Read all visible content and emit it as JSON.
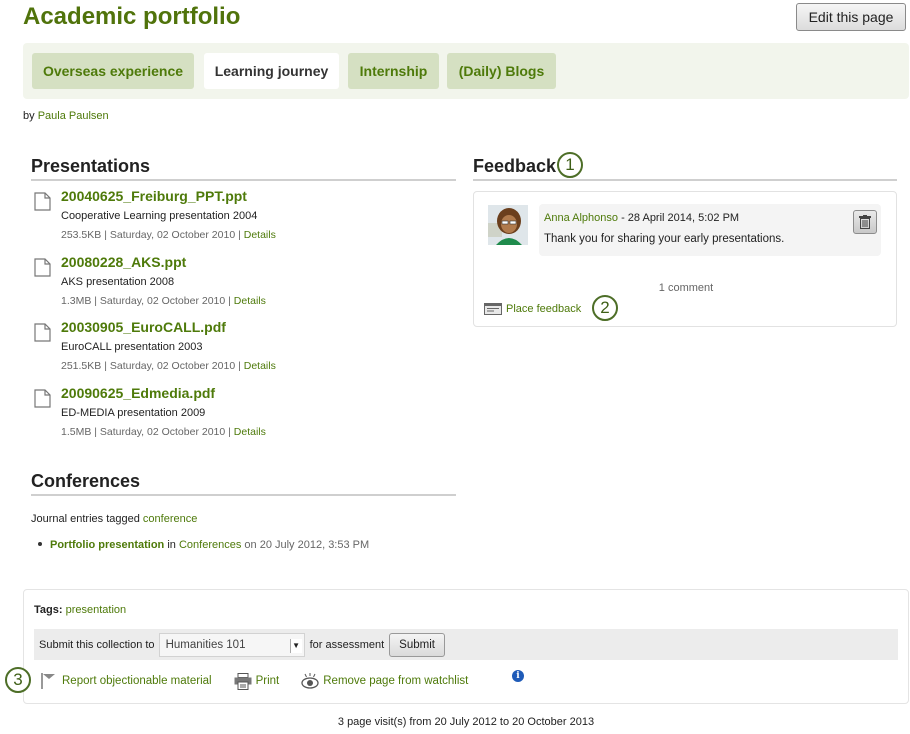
{
  "header": {
    "title": "Academic portfolio",
    "edit_button": "Edit this page"
  },
  "tabs": [
    {
      "label": "Overseas experience",
      "active": false
    },
    {
      "label": "Learning journey",
      "active": true
    },
    {
      "label": "Internship",
      "active": false
    },
    {
      "label": "(Daily) Blogs",
      "active": false
    }
  ],
  "byline": {
    "prefix": "by",
    "author": "Paula Paulsen"
  },
  "presentations": {
    "title": "Presentations",
    "files": [
      {
        "name": "20040625_Freiburg_PPT.ppt",
        "description": "Cooperative Learning presentation 2004",
        "size": "253.5KB",
        "date": "Saturday, 02 October 2010",
        "details": "Details",
        "icon": "file-icon"
      },
      {
        "name": "20080228_AKS.ppt",
        "description": "AKS presentation 2008",
        "size": "1.3MB",
        "date": "Saturday, 02 October 2010",
        "details": "Details",
        "icon": "file-icon"
      },
      {
        "name": "20030905_EuroCALL.pdf",
        "description": "EuroCALL presentation 2003",
        "size": "251.5KB",
        "date": "Saturday, 02 October 2010",
        "details": "Details",
        "icon": "file-icon"
      },
      {
        "name": "20090625_Edmedia.pdf",
        "description": "ED-MEDIA presentation 2009",
        "size": "1.5MB",
        "date": "Saturday, 02 October 2010",
        "details": "Details",
        "icon": "file-icon"
      }
    ],
    "separator": " | "
  },
  "conferences": {
    "title": "Conferences",
    "intro_text": "Journal entries tagged",
    "tag": "conference",
    "entries": [
      {
        "title": "Portfolio presentation",
        "in_word": "in",
        "journal": "Conferences",
        "date": "on 20 July 2012, 3:53 PM"
      }
    ]
  },
  "feedback": {
    "title": "Feedback",
    "callout_1": "1",
    "callout_2": "2",
    "comments": [
      {
        "author": "Anna Alphonso",
        "date": " - 28 April 2014, 5:02 PM",
        "text": "Thank you for sharing your early presentations.",
        "avatar": "avatar-image",
        "delete_icon": "trash-icon"
      }
    ],
    "count": "1 comment",
    "place_feedback": "Place feedback"
  },
  "footer_panel": {
    "tags_label": "Tags:",
    "tag": "presentation",
    "submit_prefix": "Submit this collection to",
    "select_value": "Humanities 101",
    "submit_suffix": "for assessment",
    "submit_button": "Submit",
    "callout_3": "3",
    "actions": [
      {
        "label": "Report objectionable material",
        "icon": "flag-icon"
      },
      {
        "label": "Print",
        "icon": "printer-icon"
      },
      {
        "label": "Remove page from watchlist",
        "icon": "eye-icon"
      }
    ],
    "info_icon": "i"
  },
  "visits": "3 page visit(s) from 20 July 2012 to 20 October 2013",
  "colors": {
    "accent_green": "#4e7a0a",
    "title_green": "#50730b",
    "tab_bg": "#d5e0c2",
    "tabbar_bg": "#f2f5ec",
    "info_blue": "#1f5bb8"
  }
}
